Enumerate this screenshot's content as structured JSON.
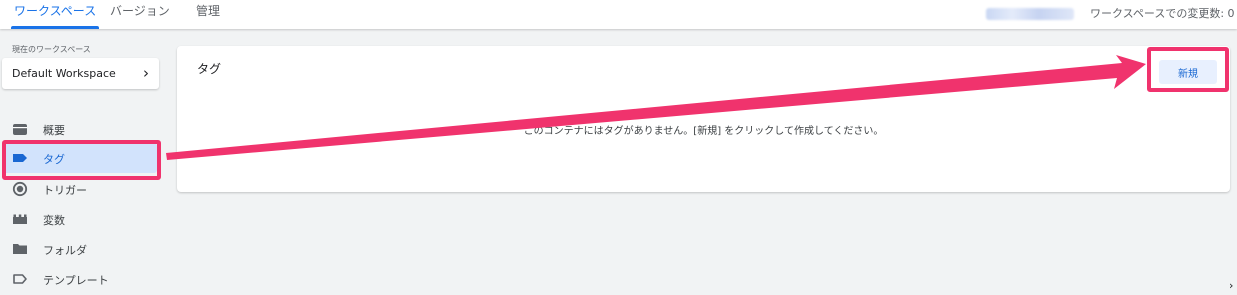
{
  "topbar": {
    "tabs": [
      {
        "label": "ワークスペース",
        "active": true
      },
      {
        "label": "バージョン",
        "active": false
      },
      {
        "label": "管理",
        "active": false
      }
    ],
    "changes_label": "ワークスペースでの変更数: 0"
  },
  "sidebar": {
    "workspace_caption": "現在のワークスペース",
    "workspace_name": "Default Workspace",
    "items": [
      {
        "label": "概要",
        "icon": "overview-icon"
      },
      {
        "label": "タグ",
        "icon": "tag-icon",
        "selected": true
      },
      {
        "label": "トリガー",
        "icon": "trigger-icon"
      },
      {
        "label": "変数",
        "icon": "variables-icon"
      },
      {
        "label": "フォルダ",
        "icon": "folder-icon"
      },
      {
        "label": "テンプレート",
        "icon": "template-icon"
      }
    ]
  },
  "main": {
    "title": "タグ",
    "new_button": "新規",
    "empty_message": "このコンテナにはタグがありません。[新規] をクリックして作成してください。"
  },
  "colors": {
    "accent": "#1a73e8",
    "selected_bg": "#d2e3fc",
    "annotation": "#f0336d",
    "background": "#f1f3f4"
  }
}
